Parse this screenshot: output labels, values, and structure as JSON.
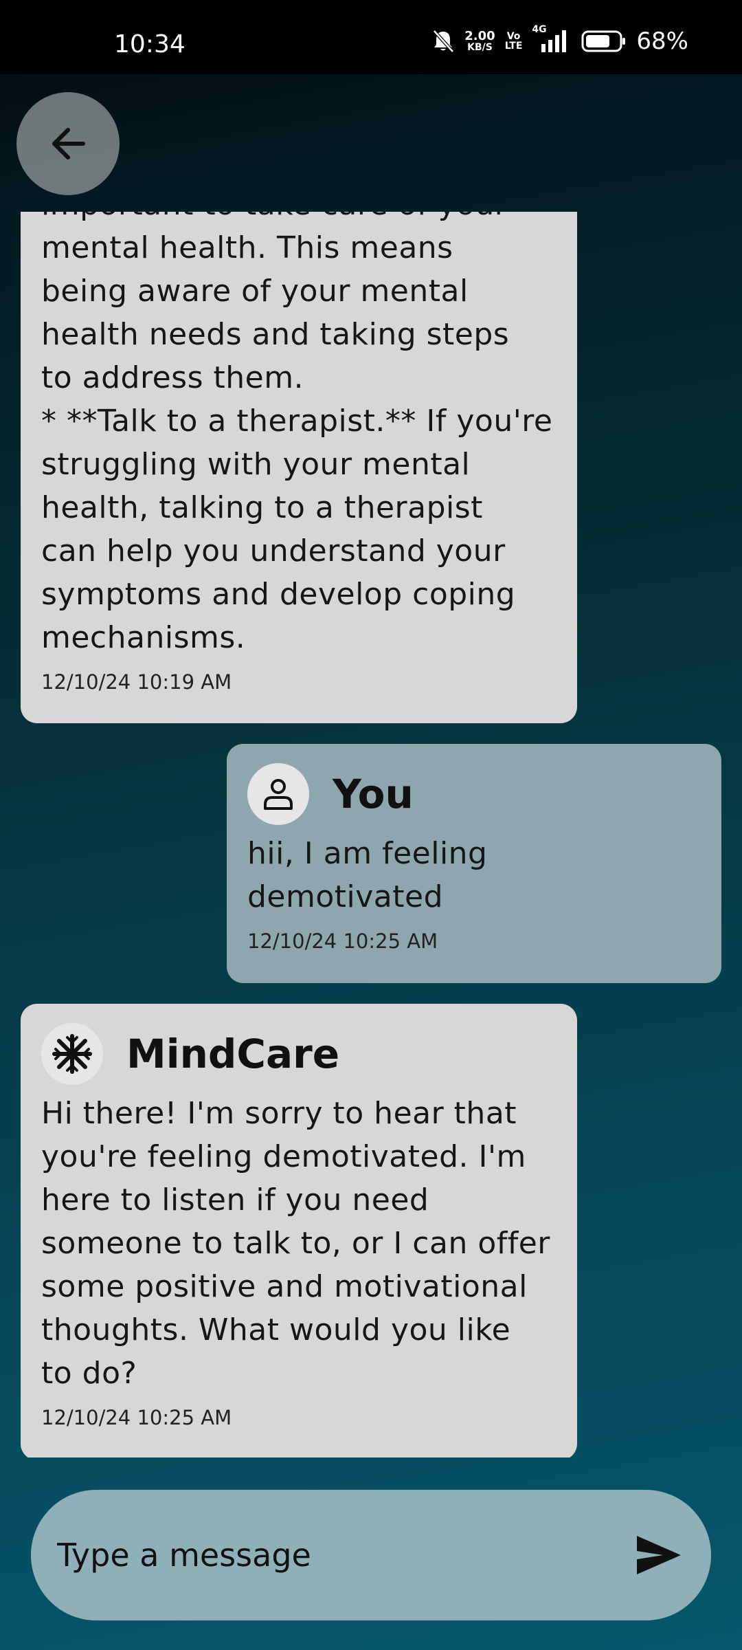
{
  "status_bar": {
    "time": "10:34",
    "network_speed_value": "2.00",
    "network_speed_unit": "KB/S",
    "volte_top": "Vo",
    "volte_bottom": "LTE",
    "network_type": "4G",
    "battery_percent": "68%",
    "icons": [
      "bell-muted-icon",
      "signal-icon",
      "battery-icon"
    ]
  },
  "header": {
    "back_icon": "arrow-left-icon"
  },
  "messages": [
    {
      "sender": "bot",
      "text": "important to take care of your\nmental health. This means\nbeing aware of your mental\nhealth needs and taking steps\nto address them.\n* **Talk to a therapist.** If you're\nstruggling with your mental\nhealth, talking to a therapist\ncan help you understand your\nsymptoms and develop coping\nmechanisms.",
      "timestamp": "12/10/24 10:19 AM"
    },
    {
      "sender": "user",
      "name": "You",
      "avatar_icon": "person-icon",
      "text": "hii, I am feeling\ndemotivated",
      "timestamp": "12/10/24 10:25 AM"
    },
    {
      "sender": "bot",
      "name": "MindCare",
      "avatar_icon": "snowflake-icon",
      "text": "Hi there! I'm sorry to hear that\nyou're feeling demotivated. I'm\nhere to listen if you need\nsomeone to talk to, or I can offer\nsome positive and motivational\nthoughts. What would you like\nto do?",
      "timestamp": "12/10/24 10:25 AM"
    }
  ],
  "composer": {
    "placeholder": "Type a message",
    "send_icon": "send-icon"
  },
  "colors": {
    "bot_bubble": "#d7d7d7",
    "user_bubble": "#8ea7ad",
    "composer": "#8fb0b8",
    "background_top": "#02080b",
    "background_bottom": "#06586c"
  }
}
